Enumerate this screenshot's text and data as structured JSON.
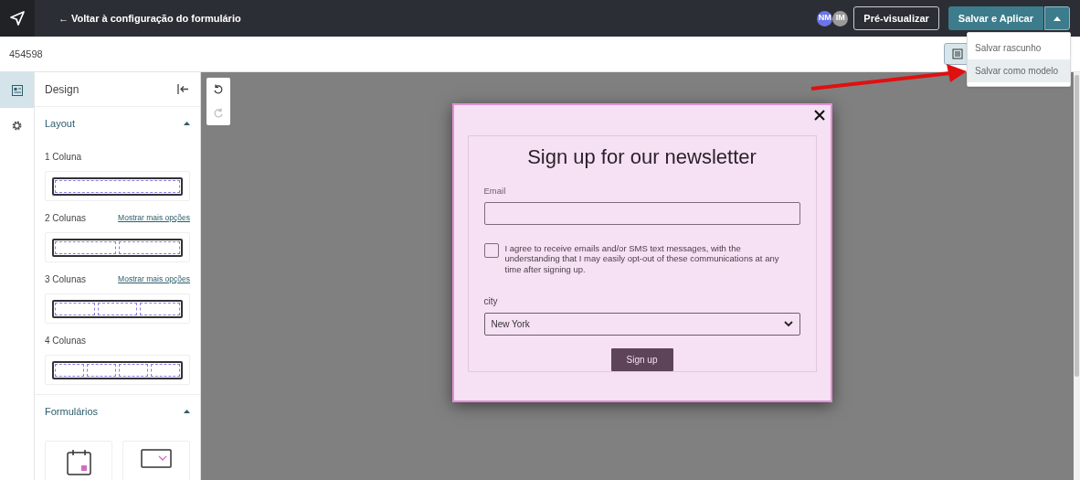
{
  "topbar": {
    "back_link": "← Voltar à configuração do formulário",
    "avatars": [
      {
        "initials": "NM",
        "color": "#6b74e8"
      },
      {
        "initials": "IM",
        "color": "#9a9a9a"
      }
    ],
    "preview_button": "Pré-visualizar",
    "save_button": "Salvar e Aplicar",
    "save_menu_expanded": true
  },
  "save_menu": [
    {
      "label": "Salvar rascunho",
      "selected": false
    },
    {
      "label": "Salvar como modelo",
      "selected": true
    }
  ],
  "form_id": "454598",
  "rail": [
    {
      "kind": "design",
      "selected": true
    },
    {
      "kind": "settings",
      "selected": false
    }
  ],
  "panel": {
    "title": "Design",
    "sections": [
      {
        "title": "Layout",
        "expanded": true,
        "options": [
          {
            "label": "1 Coluna",
            "kind": "col1"
          },
          {
            "label": "2 Colunas",
            "more_link": "Mostrar mais opções",
            "kind": "col2"
          },
          {
            "label": "3 Colunas",
            "more_link": "Mostrar mais opções",
            "kind": "col3"
          },
          {
            "label": "4 Colunas",
            "kind": "col4"
          }
        ]
      },
      {
        "title": "Formulários",
        "expanded": true,
        "tiles": [
          {
            "kind": "date"
          },
          {
            "kind": "dropdown"
          }
        ]
      }
    ]
  },
  "popup": {
    "title": "Sign up for our newsletter",
    "email_label": "Email",
    "consent": {
      "text": "I agree to receive emails and/or SMS text messages, with the understanding that I may easily opt-out of these communications at any time after signing up.",
      "checked": false
    },
    "city_label": "city",
    "city_value": "New York",
    "submit": "Sign up"
  }
}
